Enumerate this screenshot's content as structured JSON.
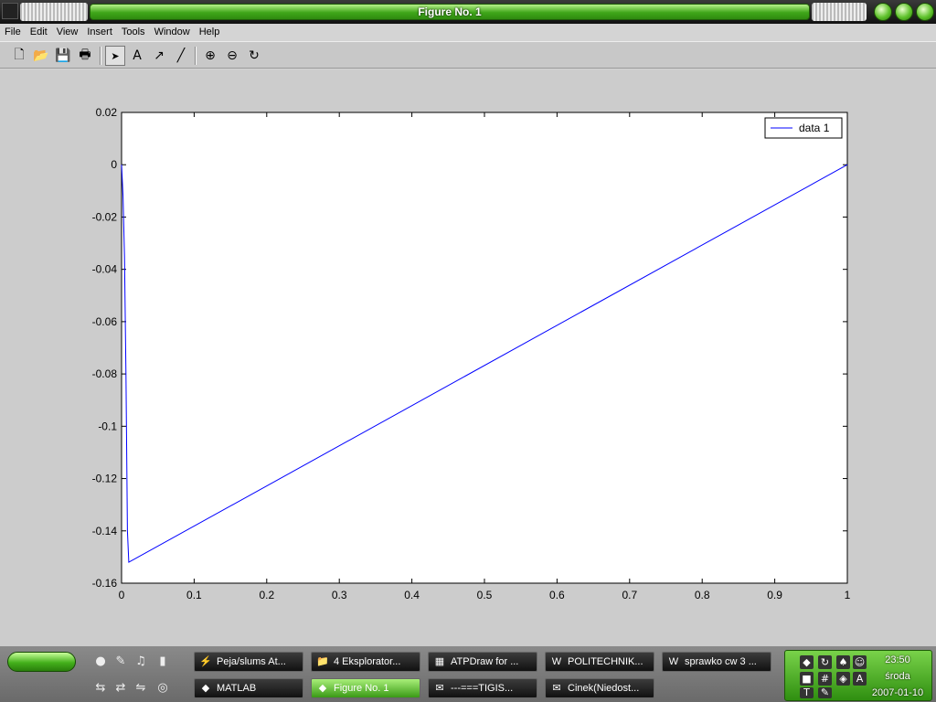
{
  "window": {
    "title": "Figure No. 1"
  },
  "menu": [
    "File",
    "Edit",
    "View",
    "Insert",
    "Tools",
    "Window",
    "Help"
  ],
  "toolbar": {
    "buttons": [
      {
        "name": "new-figure-icon",
        "glyph": "🗋"
      },
      {
        "name": "open-file-icon",
        "glyph": "📂"
      },
      {
        "name": "save-icon",
        "glyph": "💾"
      },
      {
        "name": "print-icon",
        "glyph": "🖶"
      },
      {
        "name": "select-arrow-icon",
        "glyph": "➤"
      },
      {
        "name": "insert-text-icon",
        "glyph": "A"
      },
      {
        "name": "insert-arrow-icon",
        "glyph": "↗"
      },
      {
        "name": "insert-line-icon",
        "glyph": "╱"
      },
      {
        "name": "zoom-in-icon",
        "glyph": "⊕"
      },
      {
        "name": "zoom-out-icon",
        "glyph": "⊖"
      },
      {
        "name": "rotate-3d-icon",
        "glyph": "↻"
      }
    ]
  },
  "chart_data": {
    "type": "line",
    "title": "",
    "xlabel": "",
    "ylabel": "",
    "xlim": [
      0,
      1
    ],
    "ylim": [
      -0.16,
      0.02
    ],
    "xticks": [
      "0",
      "0.1",
      "0.2",
      "0.3",
      "0.4",
      "0.5",
      "0.6",
      "0.7",
      "0.8",
      "0.9",
      "1"
    ],
    "yticks": [
      "0.02",
      "0",
      "-0.02",
      "-0.04",
      "-0.06",
      "-0.08",
      "-0.1",
      "-0.12",
      "-0.14",
      "-0.16"
    ],
    "grid": false,
    "legend_position": "top-right",
    "series": [
      {
        "name": "data 1",
        "color": "#0000ff",
        "x": [
          0,
          0.002,
          0.004,
          0.006,
          0.008,
          0.01,
          1.0
        ],
        "y": [
          0,
          -0.012,
          -0.035,
          -0.08,
          -0.14,
          -0.152,
          0
        ]
      }
    ]
  },
  "taskbar": {
    "tasks": [
      {
        "label": "Peja/slums At...",
        "icon": "⚡",
        "active": false
      },
      {
        "label": "4 Eksplorator...",
        "icon": "📁",
        "active": false
      },
      {
        "label": "ATPDraw for ...",
        "icon": "▦",
        "active": false
      },
      {
        "label": "POLITECHNIK...",
        "icon": "W",
        "active": false
      },
      {
        "label": "sprawko cw 3 ...",
        "icon": "W",
        "active": false
      },
      {
        "label": "MATLAB",
        "icon": "◆",
        "active": false
      },
      {
        "label": "Figure No. 1",
        "icon": "◆",
        "active": true
      },
      {
        "label": "---===TIGIS...",
        "icon": "✉",
        "active": false
      },
      {
        "label": "Cinek(Niedost...",
        "icon": "✉",
        "active": false
      }
    ],
    "clock": {
      "time": "23:50",
      "day": "środa",
      "date": "2007-01-10"
    }
  }
}
